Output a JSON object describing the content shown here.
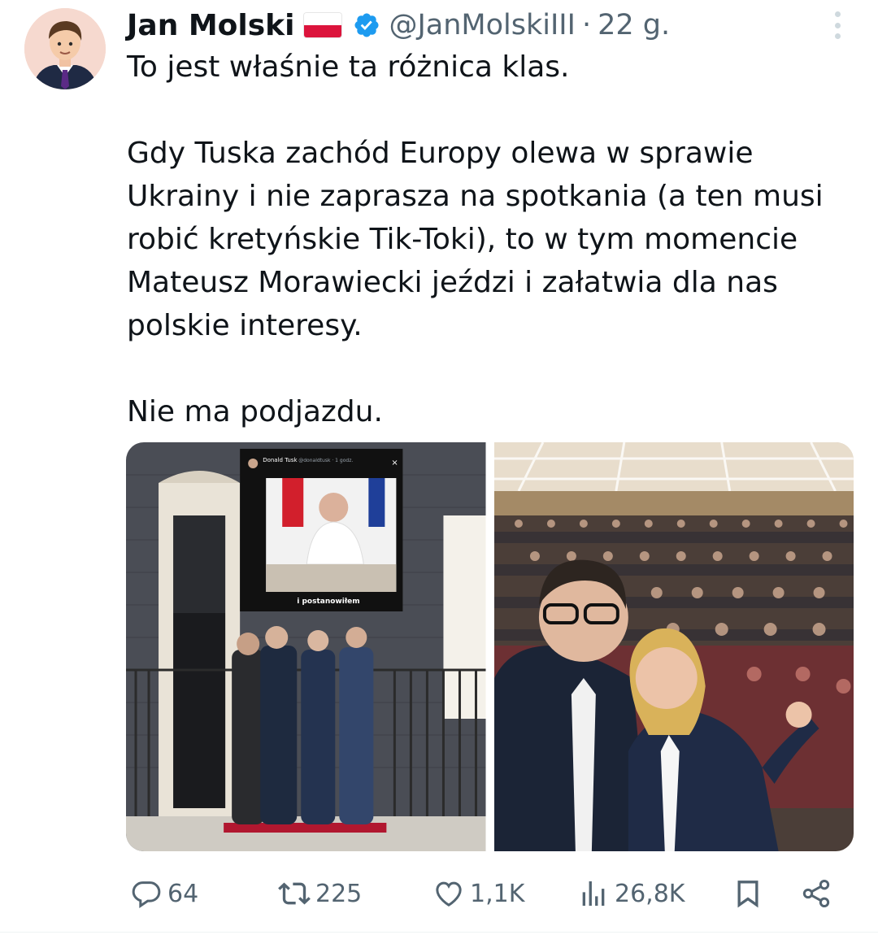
{
  "author": {
    "name": "Jan Molski",
    "handle": "@JanMolskiIII",
    "separator": "·",
    "time": "22 g."
  },
  "tweet": {
    "text": "To jest właśnie ta różnica klas.\n\nGdy Tuska zachód Europy olewa w sprawie Ukrainy i nie zaprasza na spotkania (a ten musi robić kretyńskie Tik-Toki), to w tym momencie Mateusz Morawiecki jeździ i załatwia dla nas polskie interesy.\n\nNie ma podjazdu."
  },
  "media": {
    "left_image": {
      "overlay_author": "Donald Tusk",
      "overlay_handle": "@donaldtusk · 1 godz.",
      "overlay_caption": "i postanowiłem"
    },
    "right_image": {}
  },
  "actions": {
    "replies": "64",
    "reposts": "225",
    "likes": "1,1K",
    "views": "26,8K"
  },
  "icons": {
    "verified": "verified-badge-icon",
    "flag": "poland-flag-icon",
    "more": "more-vertical-icon",
    "reply": "reply-icon",
    "repost": "repost-icon",
    "like": "heart-icon",
    "views": "views-icon",
    "bookmark": "bookmark-icon",
    "share": "share-icon"
  },
  "colors": {
    "text": "#0f1419",
    "secondary": "#536471",
    "verified": "#1d9bf0"
  }
}
